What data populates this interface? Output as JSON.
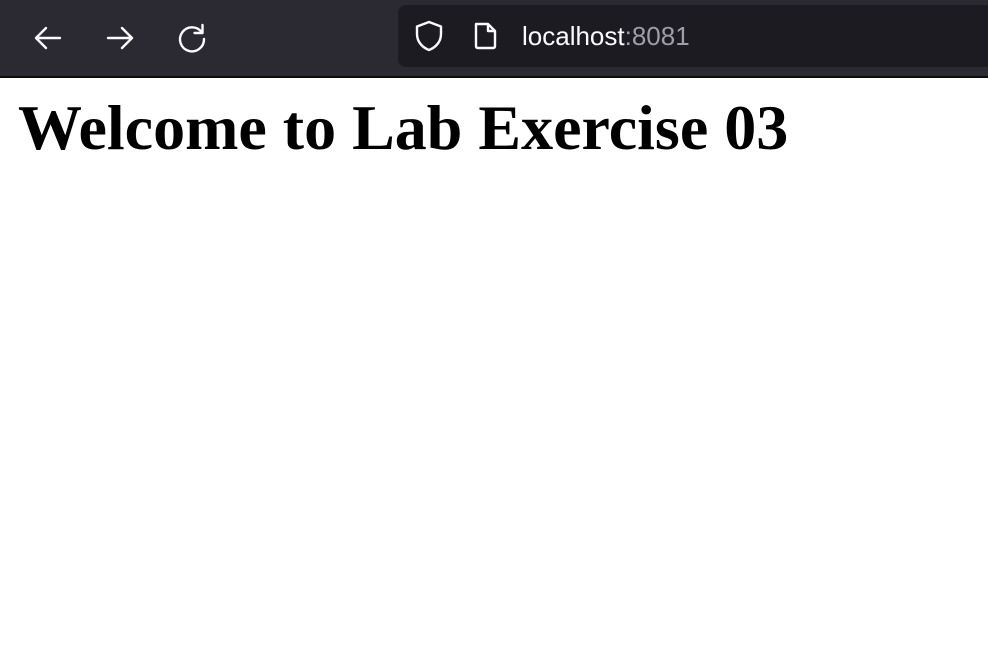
{
  "browser": {
    "url_host": "localhost",
    "url_port": ":8081",
    "icons": {
      "back": "arrow-left-icon",
      "forward": "arrow-right-icon",
      "reload": "reload-icon",
      "security": "shield-icon",
      "page": "page-icon"
    },
    "colors": {
      "toolbar": "#2b2a33",
      "urlbar": "#1c1b22"
    }
  },
  "page": {
    "heading": "Welcome to Lab Exercise 03"
  }
}
